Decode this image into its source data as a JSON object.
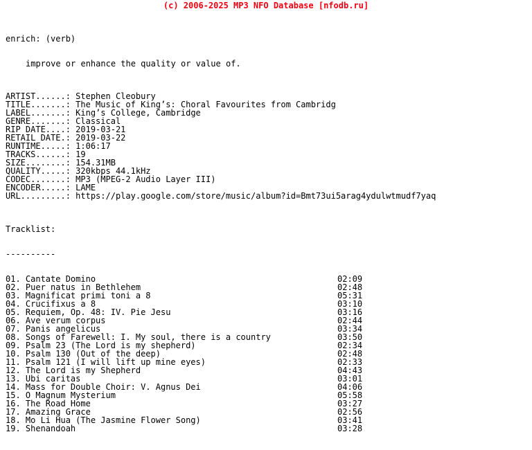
{
  "header": {
    "text": "(c) 2006-2025 MP3 NFO Database [nfodb.ru]",
    "color": "#ee0011"
  },
  "definition": {
    "term": "enrich: (verb)",
    "body": "improve or enhance the quality or value of."
  },
  "metadata": [
    {
      "label": "ARTIST......:",
      "value": "Stephen Cleobury"
    },
    {
      "label": "TITLE.......:",
      "value": "The Music of King’s: Choral Favourites from Cambridg"
    },
    {
      "label": "LABEL.......:",
      "value": "King’s College, Cambridge"
    },
    {
      "label": "GENRE.......:",
      "value": "Classical"
    },
    {
      "label": "RIP DATE....:",
      "value": "2019-03-21"
    },
    {
      "label": "RETAIL DATE.:",
      "value": "2019-03-22"
    },
    {
      "label": "RUNTIME.....:",
      "value": "1:06:17"
    },
    {
      "label": "TRACKS......:",
      "value": "19"
    },
    {
      "label": "SIZE........:",
      "value": "154.31MB"
    },
    {
      "label": "QUALITY.....:",
      "value": "320kbps 44.1kHz"
    },
    {
      "label": "CODEC.......:",
      "value": "MP3 (MPEG-2 Audio Layer III)"
    },
    {
      "label": "ENCODER.....:",
      "value": "LAME"
    },
    {
      "label": "URL.........:",
      "value": "https://play.google.com/store/music/album?id=Bmt73ui5arag4ydulwtmudf7yaq"
    }
  ],
  "tracklist": {
    "title": "Tracklist:",
    "rule": "----------",
    "tracks": [
      {
        "name": "01. Cantate Domino",
        "time": "02:09"
      },
      {
        "name": "02. Puer natus in Bethlehem",
        "time": "02:48"
      },
      {
        "name": "03. Magnificat primi toni a 8",
        "time": "05:31"
      },
      {
        "name": "04. Crucifixus a 8",
        "time": "03:10"
      },
      {
        "name": "05. Requiem, Op. 48: IV. Pie Jesu",
        "time": "03:16"
      },
      {
        "name": "06. Ave verum corpus",
        "time": "02:44"
      },
      {
        "name": "07. Panis angelicus",
        "time": "03:34"
      },
      {
        "name": "08. Songs of Farewell: I. My soul, there is a country",
        "time": "03:50"
      },
      {
        "name": "09. Psalm 23 (The Lord is my shepherd)",
        "time": "02:34"
      },
      {
        "name": "10. Psalm 130 (Out of the deep)",
        "time": "02:48"
      },
      {
        "name": "11. Psalm 121 (I will lift up mine eyes)",
        "time": "02:33"
      },
      {
        "name": "12. The Lord is my Shepherd",
        "time": "04:43"
      },
      {
        "name": "13. Ubi caritas",
        "time": "03:01"
      },
      {
        "name": "14. Mass for Double Choir: V. Agnus Dei",
        "time": "04:06"
      },
      {
        "name": "15. O Magnum Mysterium",
        "time": "05:58"
      },
      {
        "name": "16. The Road Home",
        "time": "03:27"
      },
      {
        "name": "17. Amazing Grace",
        "time": "02:56"
      },
      {
        "name": "18. Mo Li Hua (The Jasmine Flower Song)",
        "time": "03:41"
      },
      {
        "name": "19. Shenandoah",
        "time": "03:28"
      }
    ]
  }
}
